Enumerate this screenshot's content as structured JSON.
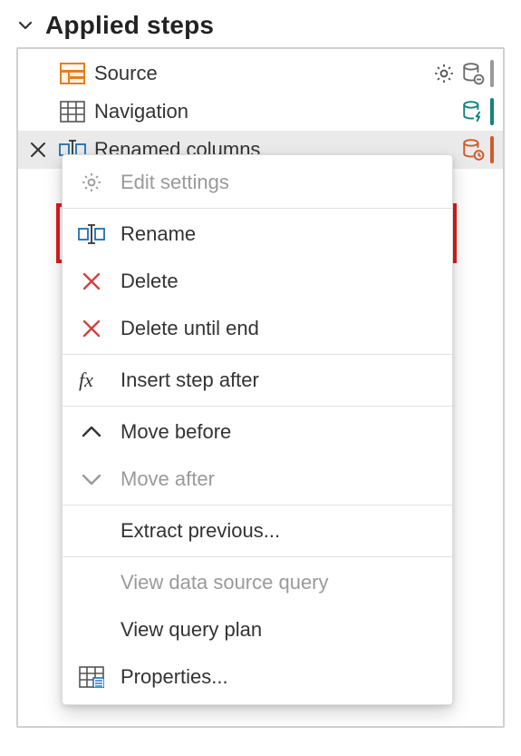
{
  "section_title": "Applied steps",
  "steps": [
    {
      "label": "Source",
      "has_settings": true
    },
    {
      "label": "Navigation",
      "has_settings": false
    },
    {
      "label": "Renamed columns",
      "has_settings": false
    }
  ],
  "context_menu": {
    "edit_settings": "Edit settings",
    "rename": "Rename",
    "delete": "Delete",
    "delete_until_end": "Delete until end",
    "insert_step": "Insert step after",
    "move_before": "Move before",
    "move_after": "Move after",
    "extract_prev": "Extract previous...",
    "view_ds_query": "View data source query",
    "view_query_plan": "View query plan",
    "properties": "Properties..."
  }
}
